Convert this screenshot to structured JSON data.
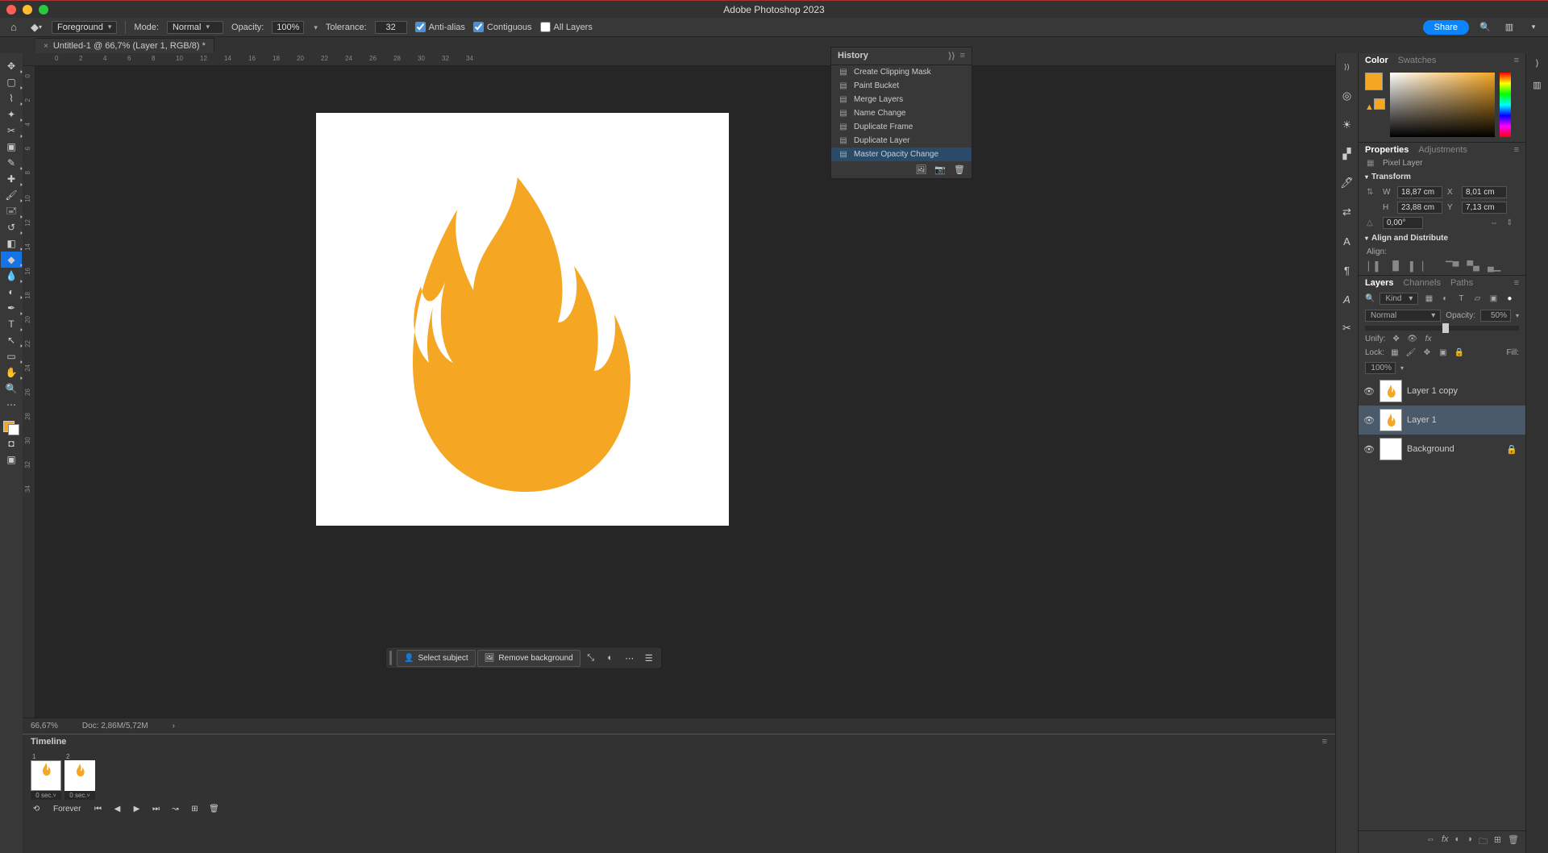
{
  "app_title": "Adobe Photoshop 2023",
  "document_tab": "Untitled-1 @ 66,7% (Layer 1, RGB/8) *",
  "options_bar": {
    "sample": "Foreground",
    "mode_label": "Mode:",
    "mode": "Normal",
    "opacity_label": "Opacity:",
    "opacity": "100%",
    "tolerance_label": "Tolerance:",
    "tolerance": "32",
    "anti_alias": "Anti-alias",
    "contiguous": "Contiguous",
    "all_layers": "All Layers",
    "share": "Share"
  },
  "context_bar": {
    "select_subject": "Select subject",
    "remove_bg": "Remove background"
  },
  "status": {
    "zoom": "66,67%",
    "doc": "Doc: 2,86M/5,72M"
  },
  "ruler_marks": [
    "0",
    "2",
    "4",
    "6",
    "8",
    "10",
    "12",
    "14",
    "16",
    "18",
    "20",
    "22",
    "24",
    "26",
    "28",
    "30",
    "32",
    "34"
  ],
  "history": {
    "title": "History",
    "items": [
      "Create Clipping Mask",
      "Paint Bucket",
      "Merge Layers",
      "Name Change",
      "Duplicate Frame",
      "Duplicate Layer",
      "Master Opacity Change"
    ],
    "selected": 6
  },
  "color_panel": {
    "tab1": "Color",
    "tab2": "Swatches"
  },
  "properties": {
    "tab1": "Properties",
    "tab2": "Adjustments",
    "type": "Pixel Layer",
    "transform": "Transform",
    "w_label": "W",
    "w": "18,87 cm",
    "x_label": "X",
    "x": "8,01 cm",
    "h_label": "H",
    "h": "23,88 cm",
    "y_label": "Y",
    "y": "7,13 cm",
    "angle": "0,00°",
    "align_title": "Align and Distribute",
    "align_label": "Align:"
  },
  "layers_panel": {
    "tab1": "Layers",
    "tab2": "Channels",
    "tab3": "Paths",
    "kind": "Kind",
    "blend": "Normal",
    "opacity_label": "Opacity:",
    "opacity": "50%",
    "unify": "Unify:",
    "lock_label": "Lock:",
    "fill_label": "Fill:",
    "fill": "100%",
    "items": [
      {
        "name": "Layer 1 copy",
        "locked": false
      },
      {
        "name": "Layer 1",
        "locked": false
      },
      {
        "name": "Background",
        "locked": true
      }
    ],
    "selected": 1
  },
  "timeline": {
    "title": "Timeline",
    "frames": [
      {
        "n": "1",
        "dur": "0 sec."
      },
      {
        "n": "2",
        "dur": "0 sec."
      }
    ],
    "selected": 1,
    "loop": "Forever"
  }
}
